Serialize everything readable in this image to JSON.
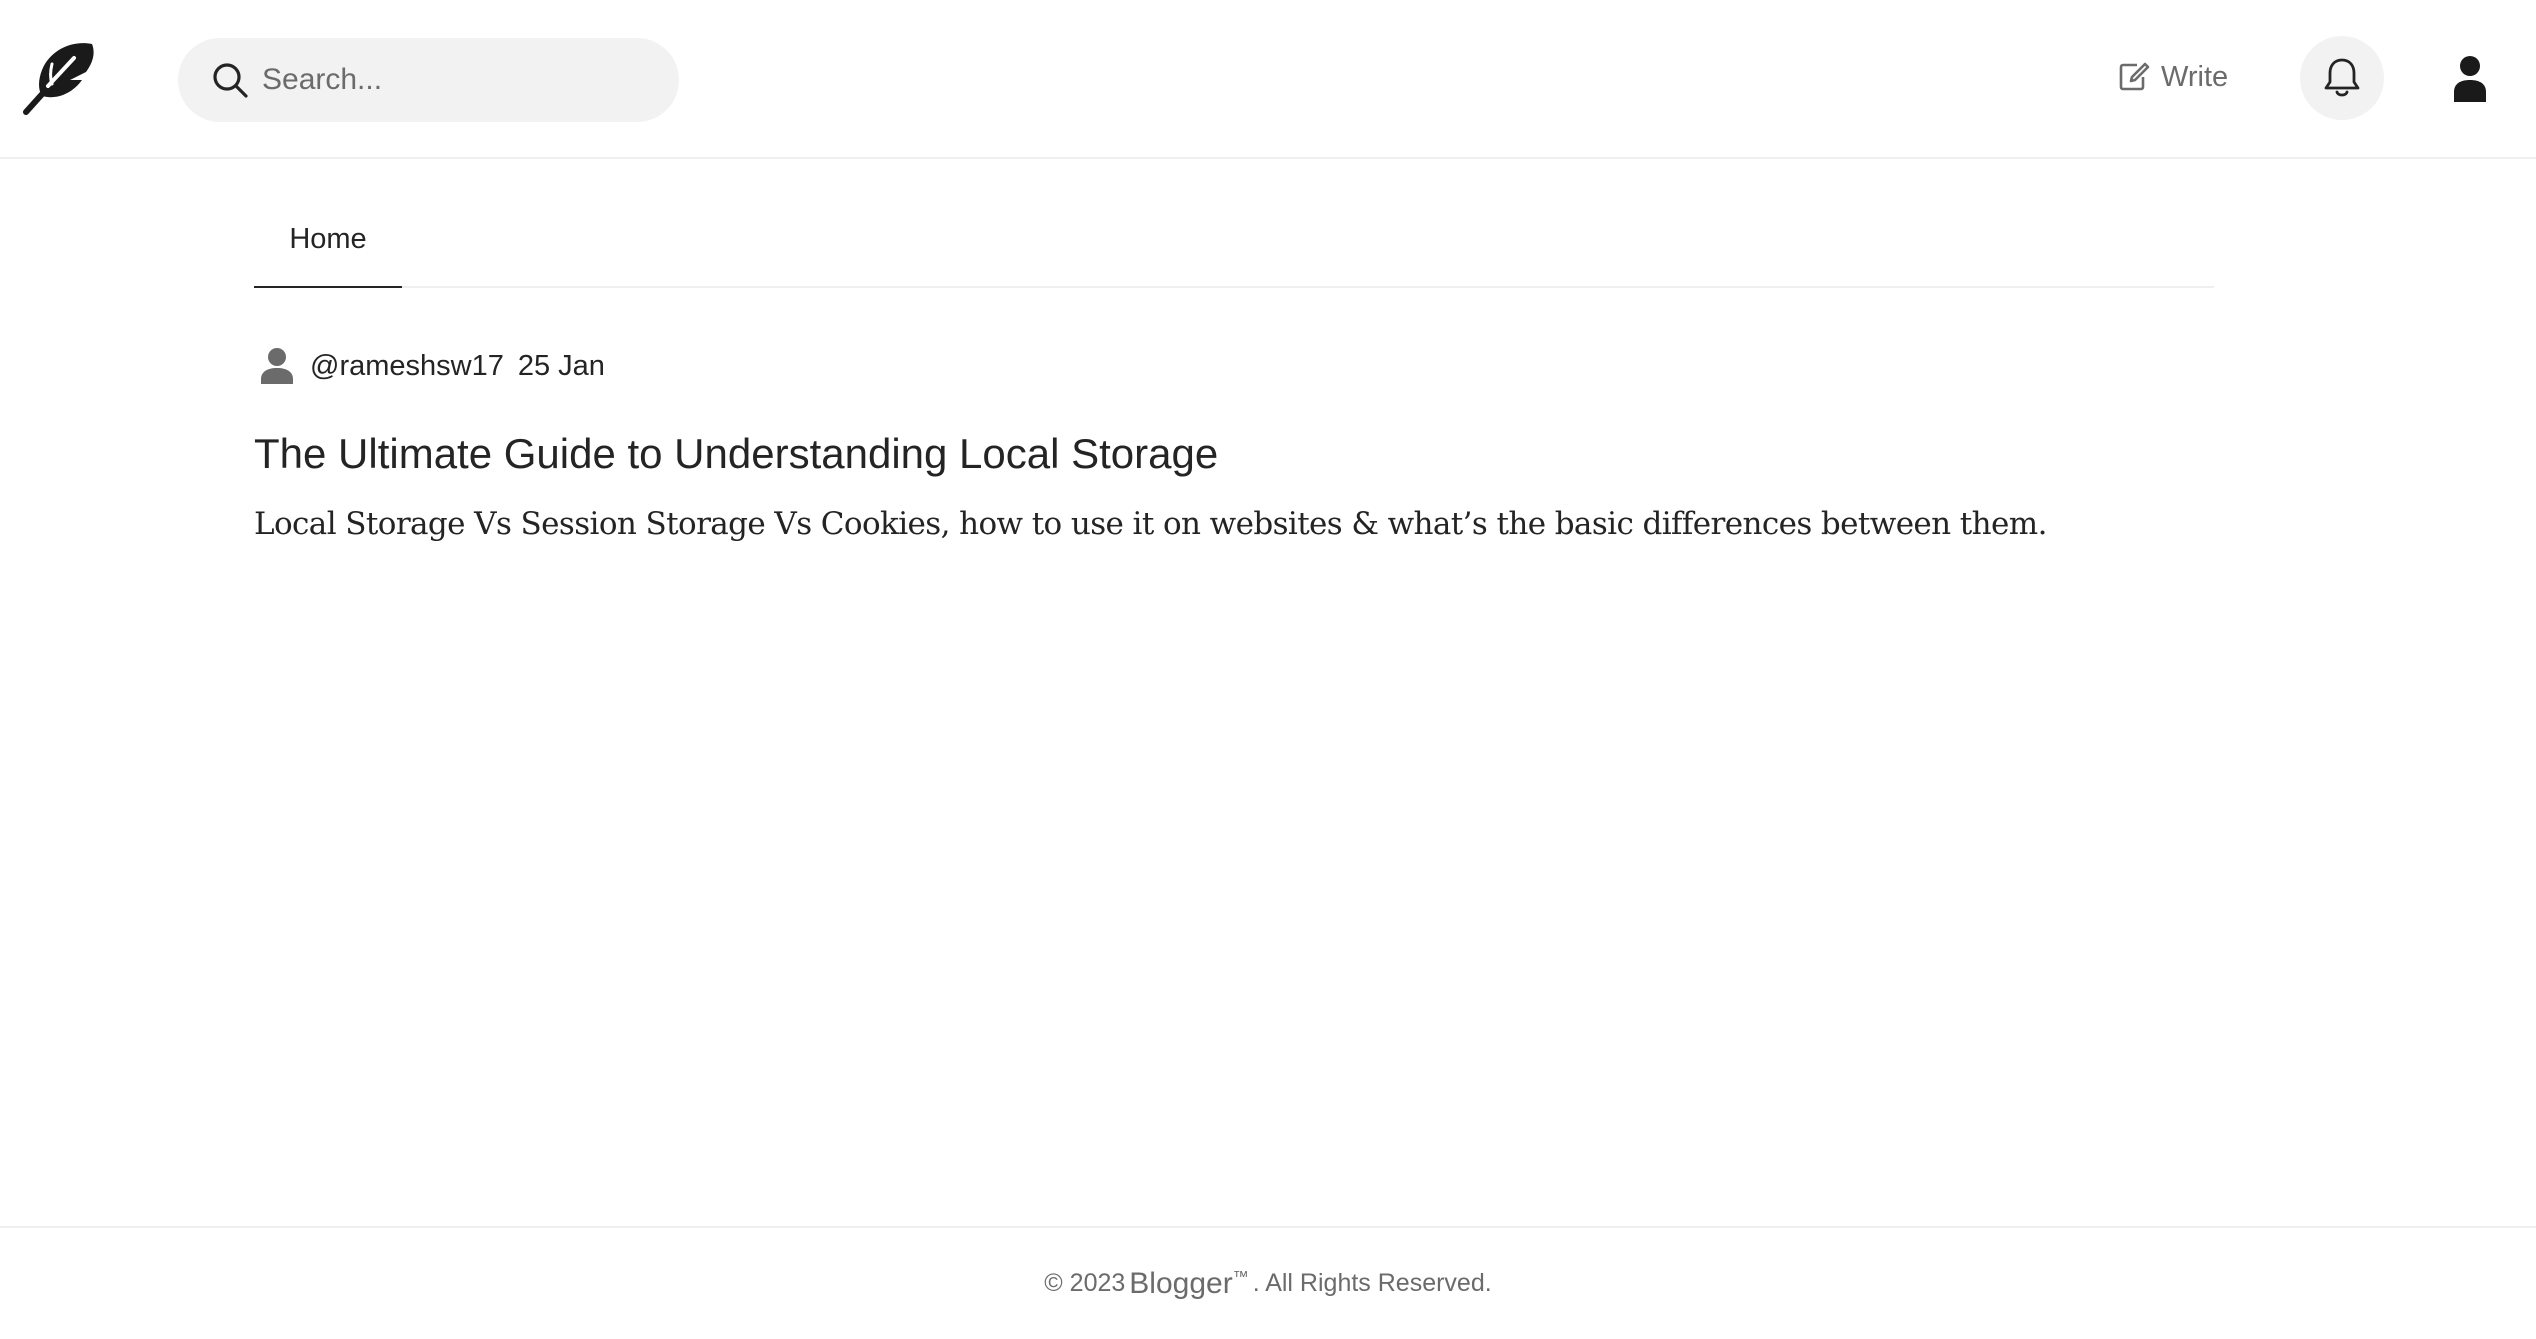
{
  "header": {
    "search_placeholder": "Search...",
    "write_label": "Write"
  },
  "nav": {
    "tabs": [
      {
        "label": "Home",
        "active": true
      }
    ]
  },
  "post": {
    "author": "@rameshsw17",
    "date": "25 Jan",
    "title": "The Ultimate Guide to Understanding Local Storage",
    "excerpt": "Local Storage Vs Session Storage Vs Cookies, how to use it on websites & what’s the basic differences between them."
  },
  "footer": {
    "copyright_prefix": "© 2023",
    "brand": "Blogger",
    "trademark": "™",
    "rights": ". All Rights Reserved."
  },
  "colors": {
    "text": "#242424",
    "muted": "#6b6b6b",
    "surface": "#f2f2f2",
    "border": "#efefef"
  },
  "icons": {
    "logo": "feather-icon",
    "search": "search-icon",
    "write": "edit-icon",
    "notifications": "bell-icon",
    "profile": "user-icon",
    "author": "user-icon"
  }
}
